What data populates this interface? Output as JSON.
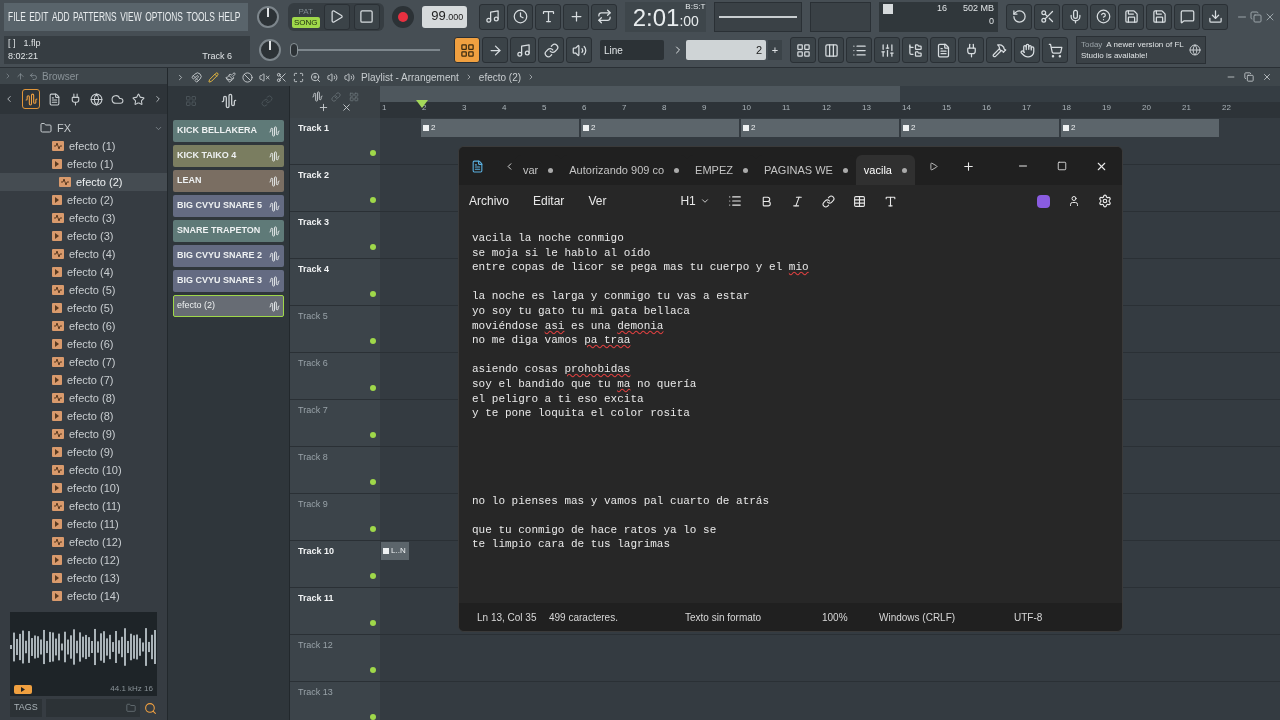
{
  "menu": [
    "FILE",
    "EDIT",
    "ADD",
    "PATTERNS",
    "VIEW",
    "OPTIONS",
    "TOOLS",
    "HELP"
  ],
  "transport": {
    "modes": [
      {
        "label": "PAT",
        "selected": false
      },
      {
        "label": "SONG",
        "selected": true
      }
    ],
    "recording": true,
    "tempo": "99",
    "tempo_decimals": ".000"
  },
  "time": {
    "main": "2:01",
    "sub": ":00",
    "format": "B:S:T"
  },
  "monitor": {
    "cpu": "16",
    "memory": "502 MB",
    "polyphony": "0"
  },
  "project": {
    "flags": "[   ]",
    "file": "1.flp",
    "elapsed": "8:02:21",
    "hint": "Track 6"
  },
  "master_pitch": {
    "level": 0
  },
  "snap": "Line",
  "pattern": "2",
  "pattern_add": "+",
  "news": {
    "date": "Today",
    "message": "A newer version of FL Studio is available!"
  },
  "browser": {
    "title": "Browser",
    "tree": [
      {
        "label": "FX",
        "kind": "folder",
        "expanded": true,
        "children": [
          {
            "label": "efecto (1)",
            "kind": "audio",
            "selected": false
          },
          {
            "label": "efecto (1)",
            "kind": "clip",
            "selected": false
          },
          {
            "label": "efecto (2)",
            "kind": "audio",
            "selected": true
          },
          {
            "label": "efecto (2)",
            "kind": "clip",
            "selected": false
          },
          {
            "label": "efecto (3)",
            "kind": "audio",
            "selected": false
          },
          {
            "label": "efecto (3)",
            "kind": "clip",
            "selected": false
          },
          {
            "label": "efecto (4)",
            "kind": "audio",
            "selected": false
          },
          {
            "label": "efecto (4)",
            "kind": "clip",
            "selected": false
          },
          {
            "label": "efecto (5)",
            "kind": "audio",
            "selected": false
          },
          {
            "label": "efecto (5)",
            "kind": "clip",
            "selected": false
          },
          {
            "label": "efecto (6)",
            "kind": "audio",
            "selected": false
          },
          {
            "label": "efecto (6)",
            "kind": "clip",
            "selected": false
          },
          {
            "label": "efecto (7)",
            "kind": "audio",
            "selected": false
          },
          {
            "label": "efecto (7)",
            "kind": "clip",
            "selected": false
          },
          {
            "label": "efecto (8)",
            "kind": "audio",
            "selected": false
          },
          {
            "label": "efecto (8)",
            "kind": "clip",
            "selected": false
          },
          {
            "label": "efecto (9)",
            "kind": "audio",
            "selected": false
          },
          {
            "label": "efecto (9)",
            "kind": "clip",
            "selected": false
          },
          {
            "label": "efecto (10)",
            "kind": "audio",
            "selected": false
          },
          {
            "label": "efecto (10)",
            "kind": "clip",
            "selected": false
          },
          {
            "label": "efecto (11)",
            "kind": "audio",
            "selected": false
          },
          {
            "label": "efecto (11)",
            "kind": "clip",
            "selected": false
          },
          {
            "label": "efecto (12)",
            "kind": "audio",
            "selected": false
          },
          {
            "label": "efecto (12)",
            "kind": "clip",
            "selected": false
          },
          {
            "label": "efecto (13)",
            "kind": "clip",
            "selected": false
          },
          {
            "label": "efecto (14)",
            "kind": "clip",
            "selected": false
          }
        ]
      }
    ],
    "preview_info": "44.1 kHz 16",
    "tags": "TAGS"
  },
  "channels": [
    {
      "label": "KICK BELLAKERA",
      "color": "#5f7a78",
      "selected": false
    },
    {
      "label": "KICK TAIKO 4",
      "color": "#7a7d60",
      "selected": false
    },
    {
      "label": "LEAN",
      "color": "#7a6e62",
      "selected": false
    },
    {
      "label": "BIG CVYU SNARE 5",
      "color": "#646b82",
      "selected": false
    },
    {
      "label": "SNARE TRAPETON",
      "color": "#5f7a78",
      "selected": false
    },
    {
      "label": "BIG CVYU SNARE 2",
      "color": "#646b82",
      "selected": false
    },
    {
      "label": "BIG CVYU SNARE 3",
      "color": "#646b82",
      "selected": false
    },
    {
      "label": "efecto (2)",
      "color": "#676c74",
      "selected": true
    }
  ],
  "playlist": {
    "title": "Playlist - Arrangement",
    "pattern": "efecto (2)",
    "ruler": [
      "1",
      "2",
      "3",
      "4",
      "5",
      "6",
      "7",
      "8",
      "9",
      "10",
      "11",
      "12",
      "13",
      "14",
      "15",
      "16",
      "17",
      "18",
      "19",
      "20",
      "21",
      "22"
    ],
    "tracks": [
      {
        "label": "Track 1",
        "dimmed": false,
        "clips": [
          "2",
          "2",
          "2",
          "2",
          "2"
        ]
      },
      {
        "label": "Track 2",
        "dimmed": false
      },
      {
        "label": "Track 3",
        "dimmed": false
      },
      {
        "label": "Track 4",
        "dimmed": false
      },
      {
        "label": "Track 5",
        "dimmed": true
      },
      {
        "label": "Track 6",
        "dimmed": true
      },
      {
        "label": "Track 7",
        "dimmed": true
      },
      {
        "label": "Track 8",
        "dimmed": true
      },
      {
        "label": "Track 9",
        "dimmed": true
      },
      {
        "label": "Track 10",
        "dimmed": false,
        "clips": [
          "L..N"
        ]
      },
      {
        "label": "Track 11",
        "dimmed": false
      },
      {
        "label": "Track 12",
        "dimmed": true
      },
      {
        "label": "Track 13",
        "dimmed": true
      }
    ]
  },
  "notepad": {
    "tabs": [
      {
        "label": "var",
        "selected": false
      },
      {
        "label": "Autorizando  909 co",
        "selected": false
      },
      {
        "label": "EMPEZ",
        "selected": false
      },
      {
        "label": "PAGINAS WE",
        "selected": false
      },
      {
        "label": "vacila",
        "selected": true
      }
    ],
    "menu": [
      "Archivo",
      "Editar",
      "Ver"
    ],
    "heading": "H1",
    "lines": [
      {
        "kind": "text",
        "segments": [
          {
            "text": "vacila la noche conmigo",
            "misspelled": false
          }
        ]
      },
      {
        "kind": "text",
        "segments": [
          {
            "text": "se moja si le hablo al oído",
            "misspelled": false
          }
        ]
      },
      {
        "kind": "text",
        "segments": [
          {
            "text": "entre copas de licor se pega mas tu cuerpo y el ",
            "misspelled": false
          },
          {
            "text": "mio",
            "misspelled": true
          }
        ]
      },
      {
        "kind": "blank"
      },
      {
        "kind": "text",
        "segments": [
          {
            "text": "la noche es larga y conmigo tu vas a estar",
            "misspelled": false
          }
        ]
      },
      {
        "kind": "text",
        "segments": [
          {
            "text": "yo soy tu gato tu mi gata bellaca",
            "misspelled": false
          }
        ]
      },
      {
        "kind": "text",
        "segments": [
          {
            "text": "moviéndose ",
            "misspelled": false
          },
          {
            "text": "asi",
            "misspelled": true
          },
          {
            "text": " es una ",
            "misspelled": false
          },
          {
            "text": "demonia",
            "misspelled": true
          }
        ]
      },
      {
        "kind": "text",
        "segments": [
          {
            "text": "no me diga vamos ",
            "misspelled": false
          },
          {
            "text": "pa traa",
            "misspelled": true
          }
        ]
      },
      {
        "kind": "blank"
      },
      {
        "kind": "text",
        "segments": [
          {
            "text": "asiendo cosas ",
            "misspelled": false
          },
          {
            "text": "prohobidas",
            "misspelled": true
          }
        ]
      },
      {
        "kind": "text",
        "segments": [
          {
            "text": "soy el bandido que tu ",
            "misspelled": false
          },
          {
            "text": "ma",
            "misspelled": true
          },
          {
            "text": " no quería",
            "misspelled": false
          }
        ]
      },
      {
        "kind": "text",
        "segments": [
          {
            "text": "el peligro a ti eso excita",
            "misspelled": false
          }
        ]
      },
      {
        "kind": "text",
        "segments": [
          {
            "text": "y te pone loquita el color rosita",
            "misspelled": false
          }
        ]
      },
      {
        "kind": "blank"
      },
      {
        "kind": "blank"
      },
      {
        "kind": "blank"
      },
      {
        "kind": "blank"
      },
      {
        "kind": "blank"
      },
      {
        "kind": "text",
        "segments": [
          {
            "text": "no lo pienses mas y vamos pal cuarto de atrás",
            "misspelled": false
          }
        ]
      },
      {
        "kind": "blank"
      },
      {
        "kind": "text",
        "segments": [
          {
            "text": "que tu conmigo de hace ratos ya lo se",
            "misspelled": false
          }
        ]
      },
      {
        "kind": "text",
        "segments": [
          {
            "text": "te limpio cara de tus lagrimas",
            "misspelled": false
          }
        ]
      }
    ],
    "status": [
      "Ln 13, Col 35",
      "499 caracteres.",
      "Texto sin formato",
      "100%",
      "Windows (CRLF)",
      "UTF-8"
    ]
  }
}
